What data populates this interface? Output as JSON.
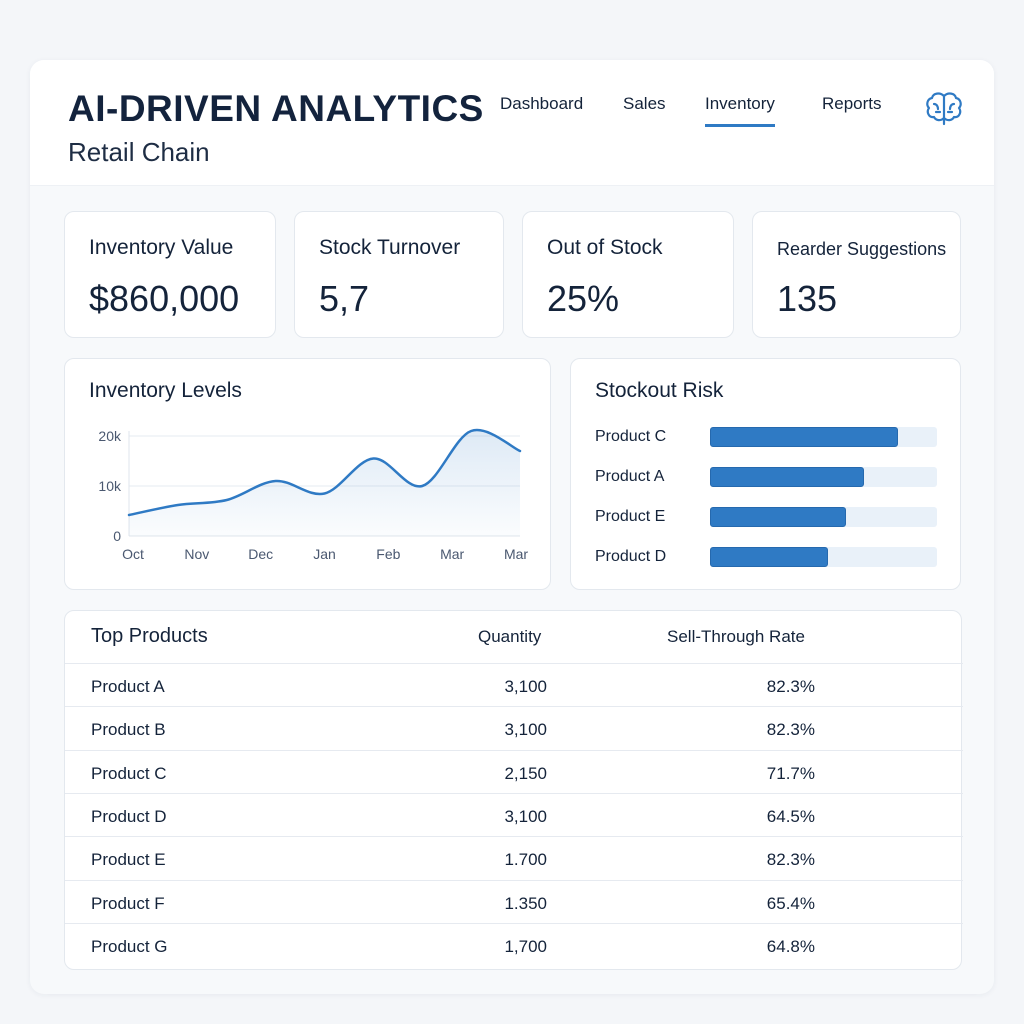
{
  "header": {
    "title": "AI-DRIVEN ANALYTICS",
    "subtitle": "Retail Chain",
    "nav": [
      {
        "label": "Dashboard",
        "active": false
      },
      {
        "label": "Sales",
        "active": false
      },
      {
        "label": "Inventory",
        "active": true
      },
      {
        "label": "Reports",
        "active": false
      }
    ],
    "icon": "brain-icon"
  },
  "kpis": [
    {
      "label": "Inventory Value",
      "value": "$860,000"
    },
    {
      "label": "Stock Turnover",
      "value": "5,7"
    },
    {
      "label": "Out of Stock",
      "value": "25%"
    },
    {
      "label": "Rearder Suggestions",
      "value": "135"
    }
  ],
  "inventory_levels": {
    "title": "Inventory Levels"
  },
  "stockout_risk": {
    "title": "Stockout Risk"
  },
  "chart_data": [
    {
      "type": "area",
      "title": "Inventory Levels",
      "x": [
        "Oct",
        "Nov",
        "Dec",
        "Jan",
        "Feb",
        "Mar",
        "Mar"
      ],
      "y_ticks": [
        "20k",
        "10k",
        "0"
      ],
      "ylim": [
        0,
        20000
      ],
      "grid": true,
      "series": [
        {
          "values": [
            4200,
            6200,
            7200,
            11000,
            8500,
            15500,
            10000,
            21000,
            17000
          ]
        }
      ],
      "series_x_positions": [
        "Oct",
        "Oct-Nov",
        "Nov",
        "Dec",
        "Dec-Jan",
        "Jan",
        "Feb",
        "Mar",
        "Mar"
      ],
      "color": "#2f7ac4"
    },
    {
      "type": "bar",
      "title": "Stockout Risk",
      "orientation": "horizontal",
      "categories": [
        "Product C",
        "Product A",
        "Product E",
        "Product D"
      ],
      "values": [
        0.83,
        0.68,
        0.6,
        0.52
      ],
      "xlim": [
        0,
        1
      ],
      "color": "#2f7ac4"
    }
  ],
  "table": {
    "title": "Top Products",
    "columns": {
      "quantity": "Quantity",
      "rate": "Sell-Through Rate"
    },
    "rows": [
      {
        "name": "Product A",
        "qty": "3,100",
        "rate": "82.3%"
      },
      {
        "name": "Product B",
        "qty": "3,100",
        "rate": "82.3%"
      },
      {
        "name": "Product C",
        "qty": "2,150",
        "rate": "71.7%"
      },
      {
        "name": "Product D",
        "qty": "3,100",
        "rate": "64.5%"
      },
      {
        "name": "Product E",
        "qty": "1.700",
        "rate": "82.3%"
      },
      {
        "name": "Product F",
        "qty": "1.350",
        "rate": "65.4%"
      },
      {
        "name": "Product G",
        "qty": "1,700",
        "rate": "64.8%"
      }
    ]
  },
  "colors": {
    "accent": "#2f7ac4",
    "text": "#14233a",
    "track": "#e9f1f9"
  }
}
